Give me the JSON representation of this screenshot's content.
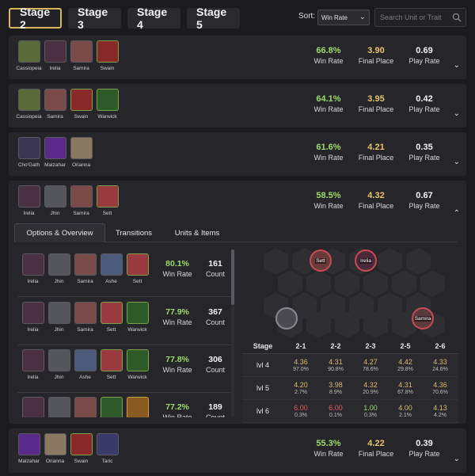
{
  "stage_tabs": [
    "Stage 2",
    "Stage 3",
    "Stage 4",
    "Stage 5"
  ],
  "sort": {
    "label": "Sort:",
    "value": "Win Rate"
  },
  "search": {
    "placeholder": "Search Unit or Trait"
  },
  "stat_labels": {
    "win_rate": "Win Rate",
    "final_place": "Final Place",
    "play_rate": "Play Rate",
    "count": "Count"
  },
  "comps": [
    {
      "units": [
        "Cassiopeia",
        "Irelia",
        "Samira",
        "Swain"
      ],
      "win_rate": "66.8%",
      "final_place": "3.90",
      "play_rate": "0.69",
      "caret": "⌄"
    },
    {
      "units": [
        "Cassiopeia",
        "Samira",
        "Swain",
        "Warwick"
      ],
      "win_rate": "64.1%",
      "final_place": "3.95",
      "play_rate": "0.42",
      "caret": "⌄"
    },
    {
      "units": [
        "Cho'Gath",
        "Malzahar",
        "Orianna"
      ],
      "win_rate": "61.6%",
      "final_place": "4.21",
      "play_rate": "0.35",
      "caret": "⌄"
    },
    {
      "units": [
        "Irelia",
        "Jhin",
        "Samira",
        "Sett"
      ],
      "win_rate": "58.5%",
      "final_place": "4.32",
      "play_rate": "0.67",
      "caret": "⌃"
    },
    {
      "units": [
        "Malzahar",
        "Orianna",
        "Swain",
        "Taric"
      ],
      "win_rate": "55.3%",
      "final_place": "4.22",
      "play_rate": "0.39",
      "caret": "⌄"
    }
  ],
  "detail_tabs": [
    "Options & Overview",
    "Transitions",
    "Units & Items"
  ],
  "options": [
    {
      "units": [
        "Irelia",
        "Jhin",
        "Samira",
        "Ashe",
        "Sett"
      ],
      "win_rate": "80.1%",
      "count": "161"
    },
    {
      "units": [
        "Irelia",
        "Jhin",
        "Samira",
        "Sett",
        "Warwick"
      ],
      "win_rate": "77.9%",
      "count": "367"
    },
    {
      "units": [
        "Irelia",
        "Jhin",
        "Ashe",
        "Sett",
        "Warwick"
      ],
      "win_rate": "77.8%",
      "count": "306"
    },
    {
      "units": [
        "",
        "",
        "",
        "",
        ""
      ],
      "win_rate": "77.2%",
      "count": "189"
    }
  ],
  "board_units": [
    "Sett",
    "Irelia",
    "Jhin",
    "Samira"
  ],
  "transitions": {
    "header": [
      "Stage",
      "2-1",
      "2-2",
      "2-3",
      "2-5",
      "2-6"
    ],
    "rows": [
      {
        "level": "lvl 4",
        "cells": [
          [
            "4.36",
            "97.0%"
          ],
          [
            "4.31",
            "90.8%"
          ],
          [
            "4.27",
            "78.6%"
          ],
          [
            "4.42",
            "29.8%"
          ],
          [
            "4.33",
            "24.6%"
          ]
        ]
      },
      {
        "level": "lvl 5",
        "cells": [
          [
            "4.20",
            "2.7%"
          ],
          [
            "3.98",
            "8.9%"
          ],
          [
            "4.32",
            "20.9%"
          ],
          [
            "4.31",
            "67.8%"
          ],
          [
            "4.36",
            "70.6%"
          ]
        ]
      },
      {
        "level": "lvl 6",
        "cells": [
          [
            "6.00",
            "0.3%"
          ],
          [
            "6.00",
            "0.1%"
          ],
          [
            "1.00",
            "0.3%"
          ],
          [
            "4.00",
            "2.1%"
          ],
          [
            "4.13",
            "4.2%"
          ]
        ]
      }
    ]
  },
  "colors": {
    "accent_gold": "#d8b65e",
    "win_green": "#9ddb6a",
    "place_gold": "#e8c46a",
    "bad_red": "#e0585a"
  }
}
